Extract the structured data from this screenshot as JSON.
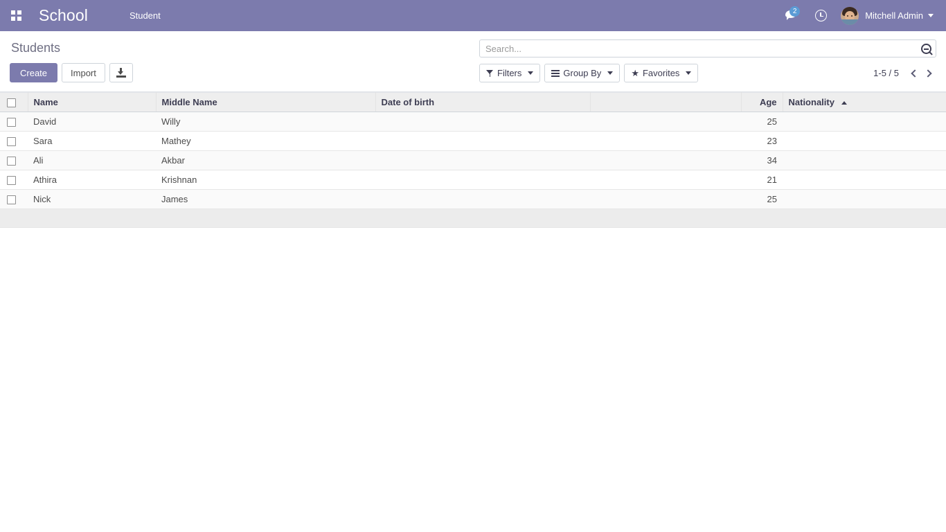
{
  "navbar": {
    "apps_icon": "apps-grid-icon",
    "brand": "School",
    "menu_items": [
      {
        "label": "Student"
      }
    ],
    "messages_icon": "message-bubble-icon",
    "messages_count": "2",
    "activity_icon": "clock-icon",
    "user_name": "Mitchell Admin",
    "user_caret": "chevron-down-icon"
  },
  "control_panel": {
    "breadcrumb": "Students",
    "create_label": "Create",
    "import_label": "Import",
    "export_icon": "download-icon",
    "search": {
      "placeholder": "Search...",
      "value": "",
      "icon": "search-minus-icon"
    },
    "filters_label": "Filters",
    "filters_icon": "funnel-icon",
    "group_by_label": "Group By",
    "group_by_icon": "bars-icon",
    "favorites_label": "Favorites",
    "favorites_icon": "star-icon",
    "pager": {
      "value": "1-5 / 5",
      "previous_icon": "chevron-left-icon",
      "next_icon": "chevron-right-icon"
    }
  },
  "list": {
    "columns": [
      {
        "key": "name",
        "label": "Name",
        "align": "left"
      },
      {
        "key": "middle_name",
        "label": "Middle Name",
        "align": "left"
      },
      {
        "key": "dob",
        "label": "Date of birth",
        "align": "left"
      },
      {
        "key": "spacer",
        "label": "",
        "align": "left"
      },
      {
        "key": "age",
        "label": "Age",
        "align": "right"
      },
      {
        "key": "nationality",
        "label": "Nationality",
        "align": "left",
        "sorted": "asc"
      }
    ],
    "rows": [
      {
        "name": "David",
        "middle_name": "Willy",
        "dob": "",
        "spacer": "",
        "age": "25",
        "nationality": ""
      },
      {
        "name": "Sara",
        "middle_name": "Mathey",
        "dob": "",
        "spacer": "",
        "age": "23",
        "nationality": ""
      },
      {
        "name": "Ali",
        "middle_name": "Akbar",
        "dob": "",
        "spacer": "",
        "age": "34",
        "nationality": ""
      },
      {
        "name": "Athira",
        "middle_name": "Krishnan",
        "dob": "",
        "spacer": "",
        "age": "21",
        "nationality": ""
      },
      {
        "name": "Nick",
        "middle_name": "James",
        "dob": "",
        "spacer": "",
        "age": "25",
        "nationality": ""
      }
    ]
  },
  "colors": {
    "brand_purple": "#7c7bad",
    "header_gray": "#eeeeee",
    "badge_blue": "#5b9bd5",
    "text_dark": "#3d3d52"
  }
}
